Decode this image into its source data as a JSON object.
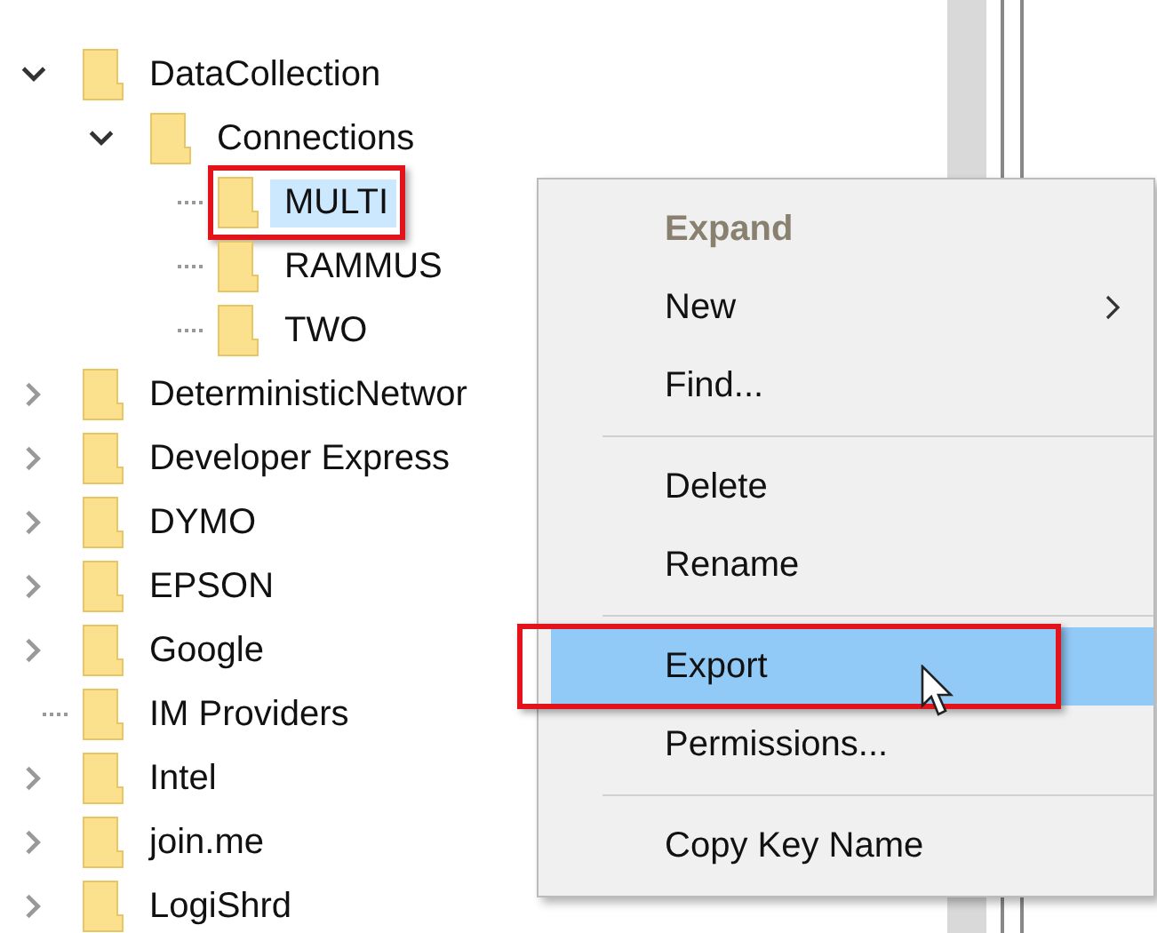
{
  "tree": [
    {
      "label": "DataCollection",
      "expanded": true,
      "selected": false,
      "annotated": false,
      "children": [
        {
          "label": "Connections",
          "expanded": true,
          "selected": false,
          "annotated": false,
          "children": [
            {
              "label": "MULTI",
              "selected": true,
              "annotated": true
            },
            {
              "label": "RAMMUS",
              "selected": false,
              "annotated": false
            },
            {
              "label": "TWO",
              "selected": false,
              "annotated": false
            }
          ]
        }
      ]
    },
    {
      "label": "DeterministicNetwor",
      "expanded": false,
      "selected": false,
      "annotated": false,
      "has_children": true
    },
    {
      "label": "Developer Express",
      "expanded": false,
      "selected": false,
      "annotated": false,
      "has_children": true
    },
    {
      "label": "DYMO",
      "expanded": false,
      "selected": false,
      "annotated": false,
      "has_children": true
    },
    {
      "label": "EPSON",
      "expanded": false,
      "selected": false,
      "annotated": false,
      "has_children": true
    },
    {
      "label": "Google",
      "expanded": false,
      "selected": false,
      "annotated": false,
      "has_children": true
    },
    {
      "label": "IM Providers",
      "selected": false,
      "annotated": false,
      "has_children": false
    },
    {
      "label": "Intel",
      "expanded": false,
      "selected": false,
      "annotated": false,
      "has_children": true
    },
    {
      "label": "join.me",
      "expanded": false,
      "selected": false,
      "annotated": false,
      "has_children": true
    },
    {
      "label": "LogiShrd",
      "expanded": false,
      "selected": false,
      "annotated": false,
      "has_children": true
    }
  ],
  "context_menu": {
    "items": [
      {
        "kind": "default",
        "label": "Expand",
        "disabled": true,
        "submenu": false,
        "selected": false,
        "annotated": false
      },
      {
        "kind": "item",
        "label": "New",
        "disabled": false,
        "submenu": true,
        "selected": false,
        "annotated": false
      },
      {
        "kind": "item",
        "label": "Find...",
        "disabled": false,
        "submenu": false,
        "selected": false,
        "annotated": false
      },
      {
        "kind": "separator"
      },
      {
        "kind": "item",
        "label": "Delete",
        "disabled": false,
        "submenu": false,
        "selected": false,
        "annotated": false
      },
      {
        "kind": "item",
        "label": "Rename",
        "disabled": false,
        "submenu": false,
        "selected": false,
        "annotated": false
      },
      {
        "kind": "separator"
      },
      {
        "kind": "item",
        "label": "Export",
        "disabled": false,
        "submenu": false,
        "selected": true,
        "annotated": true
      },
      {
        "kind": "item",
        "label": "Permissions...",
        "disabled": false,
        "submenu": false,
        "selected": false,
        "annotated": false
      },
      {
        "kind": "separator"
      },
      {
        "kind": "item",
        "label": "Copy Key Name",
        "disabled": false,
        "submenu": false,
        "selected": false,
        "annotated": false
      }
    ]
  }
}
